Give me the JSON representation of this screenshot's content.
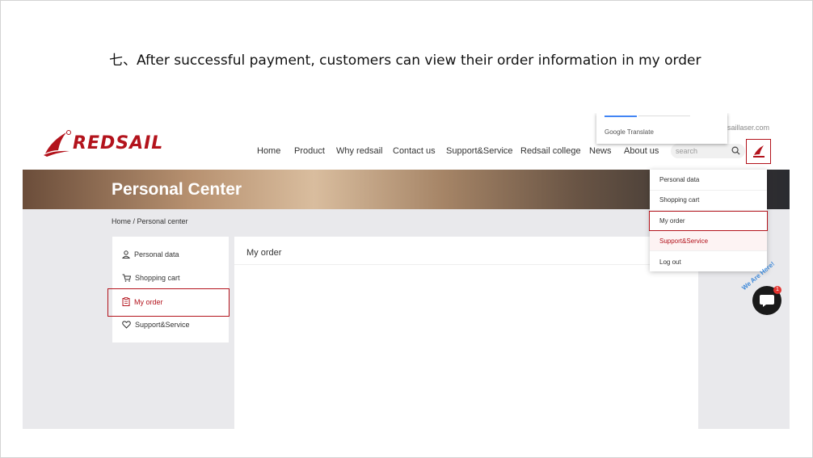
{
  "caption": "七、After successful payment, customers can view their order information in my order",
  "brand": {
    "name": "REDSAIL",
    "color": "#b3131c"
  },
  "header": {
    "nav": [
      "Home",
      "Product",
      "Why redsail",
      "Contact us",
      "Support&Service",
      "Redsail college",
      "News",
      "About us"
    ],
    "domain_partial": "saillaser.com",
    "search_placeholder": "search",
    "google_translate": "Google Translate"
  },
  "banner": {
    "title": "Personal Center"
  },
  "breadcrumb": "Home / Personal center",
  "sidebar": {
    "items": [
      {
        "label": "Personal data",
        "icon": "user-icon"
      },
      {
        "label": "Shopping cart",
        "icon": "cart-icon"
      },
      {
        "label": "My order",
        "icon": "clipboard-icon",
        "active": true
      },
      {
        "label": "Support&Service",
        "icon": "heart-icon"
      }
    ]
  },
  "main": {
    "title": "My order"
  },
  "dropdown": {
    "items": [
      "Personal data",
      "Shopping cart",
      "My order",
      "Support&Service",
      "Log out"
    ],
    "selected": "My order"
  },
  "chat": {
    "badge": "1",
    "label": "We Are Here!"
  }
}
